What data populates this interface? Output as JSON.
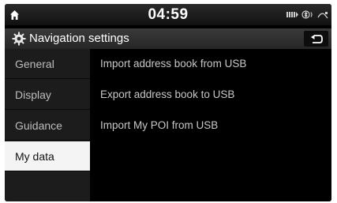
{
  "status_bar": {
    "time": "04:59",
    "home_icon": "home-icon",
    "status_icons": [
      "signal-icon",
      "bluetooth-icon",
      "network-icon"
    ]
  },
  "header": {
    "title": "Navigation settings",
    "settings_icon": "gear-icon",
    "back_icon": "back-arrow-icon"
  },
  "sidebar": {
    "items": [
      {
        "label": "General",
        "active": false
      },
      {
        "label": "Display",
        "active": false
      },
      {
        "label": "Guidance",
        "active": false
      },
      {
        "label": "My data",
        "active": true
      }
    ]
  },
  "content": {
    "items": [
      {
        "label": "Import address book from USB"
      },
      {
        "label": "Export address book to USB"
      },
      {
        "label": "Import My POI from USB"
      }
    ]
  }
}
